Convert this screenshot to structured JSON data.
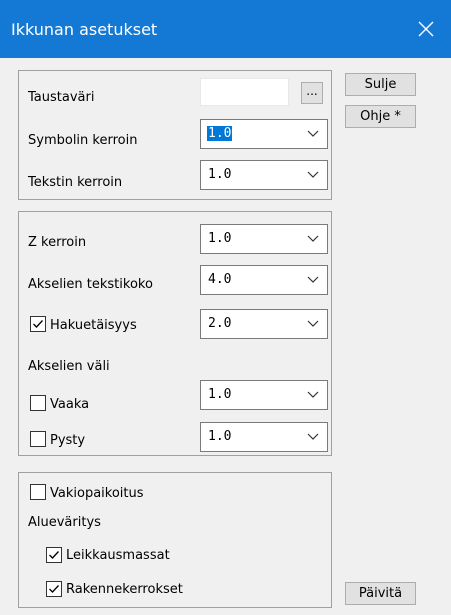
{
  "window": {
    "title": "Ikkunan asetukset",
    "close_icon": "close-icon"
  },
  "buttons": {
    "close": "Sulje",
    "help": "Ohje *",
    "update": "Päivitä",
    "color_picker": "..."
  },
  "group1": {
    "background_label": "Taustaväri",
    "symbol_label": "Symbolin kerroin",
    "symbol_value": "1.0",
    "text_label": "Tekstin kerroin",
    "text_value": "1.0"
  },
  "group2": {
    "z_label": "Z kerroin",
    "z_value": "1.0",
    "axis_text_label": "Akselien tekstikoko",
    "axis_text_value": "4.0",
    "search_label": "Hakuetäisyys",
    "search_checked": true,
    "search_value": "2.0",
    "axis_spacing_label": "Akselien väli",
    "horizontal_label": "Vaaka",
    "horizontal_checked": false,
    "horizontal_value": "1.0",
    "vertical_label": "Pysty",
    "vertical_checked": false,
    "vertical_value": "1.0"
  },
  "group3": {
    "default_position_label": "Vakiopaikoitus",
    "default_position_checked": false,
    "area_coloring_label": "Alueväritys",
    "cut_masses_label": "Leikkausmassat",
    "cut_masses_checked": true,
    "structure_layers_label": "Rakennekerrokset",
    "structure_layers_checked": true
  }
}
